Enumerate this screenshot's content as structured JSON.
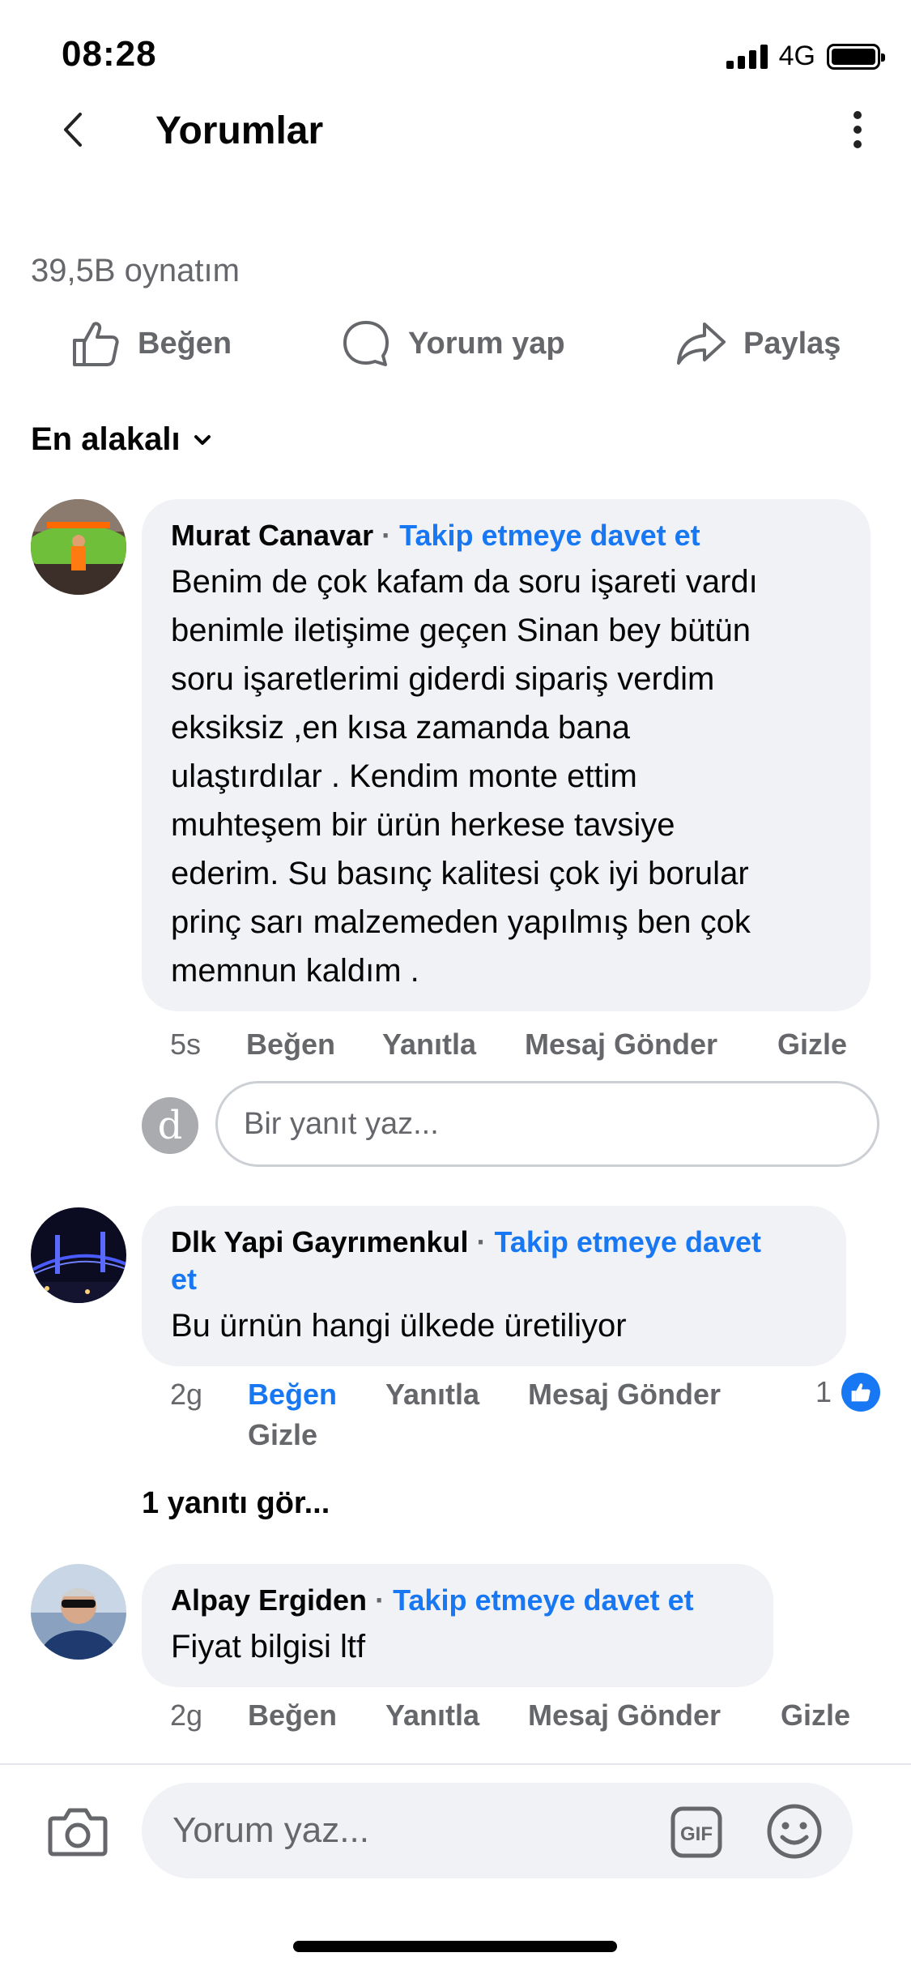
{
  "status_bar": {
    "time": "08:28",
    "network": "4G"
  },
  "header": {
    "title": "Yorumlar"
  },
  "post": {
    "play_count": "39,5B oynatım"
  },
  "actions": {
    "like": "Beğen",
    "comment": "Yorum yap",
    "share": "Paylaş"
  },
  "sort": {
    "label": "En alakalı"
  },
  "comments": [
    {
      "author": "Murat Canavar",
      "separator": "·",
      "invite": "Takip etmeye davet et",
      "lines": [
        "Benim de çok kafam da soru işareti vardı",
        "benimle iletişime geçen Sinan bey bütün",
        "soru işaretlerimi giderdi sipariş verdim",
        "eksiksiz ,en kısa zamanda bana",
        "ulaştırdılar . Kendim monte ettim",
        "muhteşem bir ürün herkese tavsiye",
        "ederim. Su basınç kalitesi çok iyi borular",
        "prinç sarı malzemeden yapılmış ben çok",
        "memnun kaldım ."
      ],
      "time": "5s",
      "like": "Beğen",
      "reply": "Yanıtla",
      "message": "Mesaj Gönder",
      "hide": "Gizle"
    },
    {
      "author": "Dlk Yapi Gayrımenkul",
      "separator": "·",
      "invite_line1": "Takip etmeye davet",
      "invite_line2": "et",
      "text": "Bu ürnün hangi ülkede üretiliyor",
      "time": "2g",
      "like": "Beğen",
      "reply": "Yanıtla",
      "message": "Mesaj Gönder",
      "hide": "Gizle",
      "reaction_count": "1"
    },
    {
      "author": "Alpay Ergiden",
      "separator": "·",
      "invite": "Takip etmeye davet et",
      "text": "Fiyat bilgisi ltf",
      "time": "2g",
      "like": "Beğen",
      "reply": "Yanıtla",
      "message": "Mesaj Gönder",
      "hide": "Gizle"
    }
  ],
  "reply_box": {
    "avatar_letter": "d",
    "placeholder": "Bir yanıt yaz..."
  },
  "see_replies": "1 yanıtı gör...",
  "composer": {
    "placeholder": "Yorum yaz...",
    "gif_label": "GIF"
  },
  "colors": {
    "accent": "#1877f2",
    "secondary_text": "#65676b",
    "bubble": "#f0f2f5"
  },
  "icons": [
    "back-arrow-icon",
    "more-vertical-icon",
    "thumbs-up-icon",
    "comment-bubble-icon",
    "share-arrow-icon",
    "chevron-down-icon",
    "camera-icon",
    "gif-icon",
    "emoji-icon"
  ]
}
